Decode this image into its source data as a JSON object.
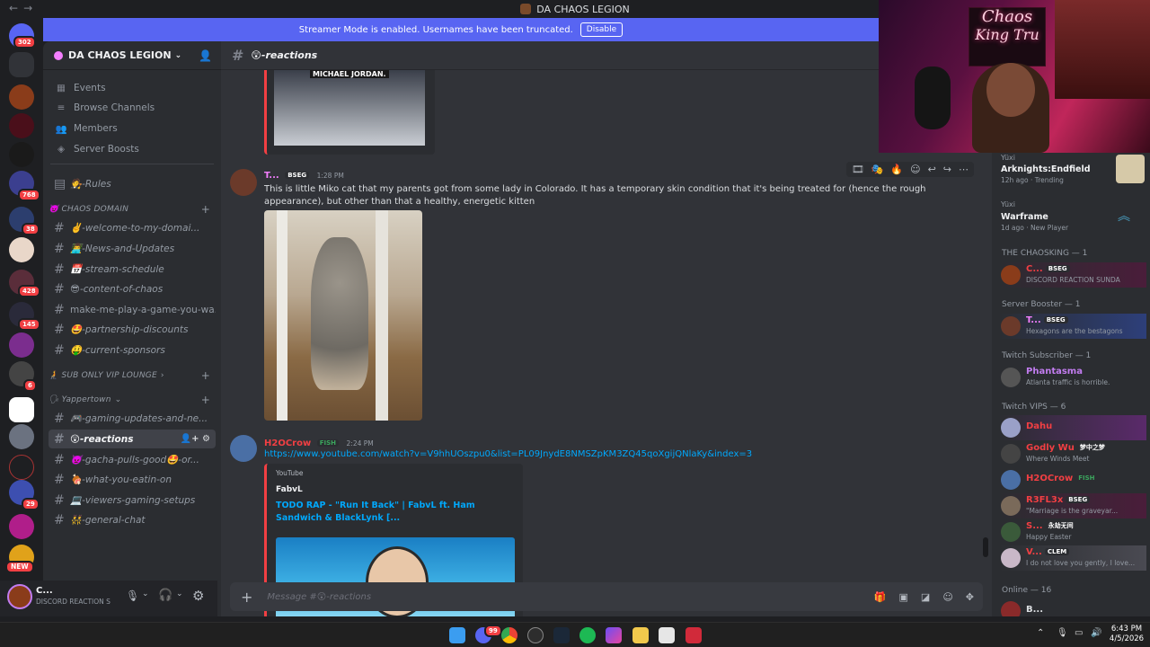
{
  "window": {
    "title": "DA CHAOS LEGION",
    "back": "←",
    "forward": "→"
  },
  "banner": {
    "text": "Streamer Mode is enabled. Usernames have been truncated.",
    "button": "Disable"
  },
  "rail": {
    "dm_badge": "302",
    "badges": [
      "768",
      "38",
      "428",
      "145",
      "6",
      "29"
    ],
    "new_label": "NEW"
  },
  "guild": {
    "name": "DA CHAOS LEGION"
  },
  "sidebar": {
    "items": [
      {
        "icon": "calendar-icon",
        "label": "Events"
      },
      {
        "icon": "browse-icon",
        "label": "Browse Channels"
      },
      {
        "icon": "members-icon",
        "label": "Members"
      },
      {
        "icon": "boost-icon",
        "label": "Server Boosts"
      }
    ],
    "rules": "🧑‍⚖️-Rules",
    "categories": {
      "chaos_domain": "👿 CHAOS DOMAIN",
      "vip": "🧎 SUB ONLY VIP LOUNGE",
      "yapper": "🗣 Yappertown"
    },
    "channels_chaos": [
      "✌️-welcome-to-my-domai...",
      "👨‍💻-News-and-Updates",
      "📅-stream-schedule",
      "😎-content-of-chaos",
      "make-me-play-a-game-you-wa...",
      "🤩-partnership-discounts",
      "🤑-current-sponsors"
    ],
    "channels_yapper": [
      "🎮-gaming-updates-and-ne...",
      "😲-reactions",
      "👿-gacha-pulls-good🤩-or...",
      "🍖-what-you-eatin-on",
      "💻-viewers-gaming-setups",
      "👯-general-chat"
    ]
  },
  "user_panel": {
    "name": "C...",
    "status": "DISCORD REACTION S"
  },
  "channel": {
    "name": "😲-reactions",
    "composer_placeholder": "Message #😲-reactions"
  },
  "messages": [
    {
      "author": "T...",
      "tag": "BSEG",
      "time": "1:28 PM",
      "text": "This is little Miko cat that my parents got from some lady in Colorado. It has a temporary skin condition that it's being treated for (hence the rough appearance), but other than that a healthy, energetic kitten"
    },
    {
      "author": "H2OCrow",
      "tag": "FISH",
      "time": "2:24 PM",
      "link": "https://www.youtube.com/watch?v=V9hhUOszpu0&list=PL09JnydE8NMSZpKM3ZQ45qoXgijQNlaKy&index=3",
      "embed": {
        "provider": "YouTube",
        "author": "FabvL",
        "title": "TODO RAP - \"Run It Back\" | FabvL ft. Ham Sandwich & BlackLynk [..."
      }
    }
  ],
  "prior_embed_caption": "MICHAEL JORDAN.",
  "members": {
    "activities": [
      {
        "user": "Yüxi",
        "game": "Arknights:Endfield",
        "meta": "12h ago  ·  Trending"
      },
      {
        "user": "Yüxi",
        "game": "Warframe",
        "meta": "1d ago  ·  New Player"
      }
    ],
    "groups": [
      {
        "header": "THE CHAOSKING — 1",
        "members": [
          {
            "name": "C...",
            "tag": "BSEG",
            "status": "DISCORD REACTION SUNDA",
            "color": "#f23f43"
          }
        ]
      },
      {
        "header": "Server Booster — 1",
        "members": [
          {
            "name": "T...",
            "tag": "BSEG",
            "status": "Hexagons are the bestagons",
            "color": "#f47fff"
          }
        ]
      },
      {
        "header": "Twitch Subscriber — 1",
        "members": [
          {
            "name": "Phantasma",
            "tag": "",
            "status": "Atlanta traffic is horrible.",
            "color": "#c27cf0"
          }
        ]
      },
      {
        "header": "Twitch VIPS — 6",
        "members": [
          {
            "name": "Dahu",
            "tag": "",
            "status": "",
            "color": "#f23f43"
          },
          {
            "name": "Godly Wu",
            "tag": "梦中之梦",
            "status": "Where Winds Meet",
            "color": "#f23f43"
          },
          {
            "name": "H2OCrow",
            "tag": "FISH",
            "status": "",
            "color": "#f23f43"
          },
          {
            "name": "R3FL3x",
            "tag": "BSEG",
            "status": "\"Marriage is the graveyar...",
            "color": "#f23f43"
          },
          {
            "name": "S...",
            "tag": "永劫无间",
            "status": "Happy Easter",
            "color": "#f23f43"
          },
          {
            "name": "V...",
            "tag": "CLEM",
            "status": "I do not love you gently, I love...",
            "color": "#f23f43"
          }
        ]
      },
      {
        "header": "Online — 16",
        "members": [
          {
            "name": "B...",
            "tag": "",
            "status": "",
            "color": "#dbdee1"
          }
        ]
      }
    ]
  },
  "webcam": {
    "neon_line1": "Chaos",
    "neon_line2": "King Tru"
  },
  "taskbar": {
    "time": "6:43 PM",
    "date": "4/5/2026",
    "discord_badge": "99"
  }
}
